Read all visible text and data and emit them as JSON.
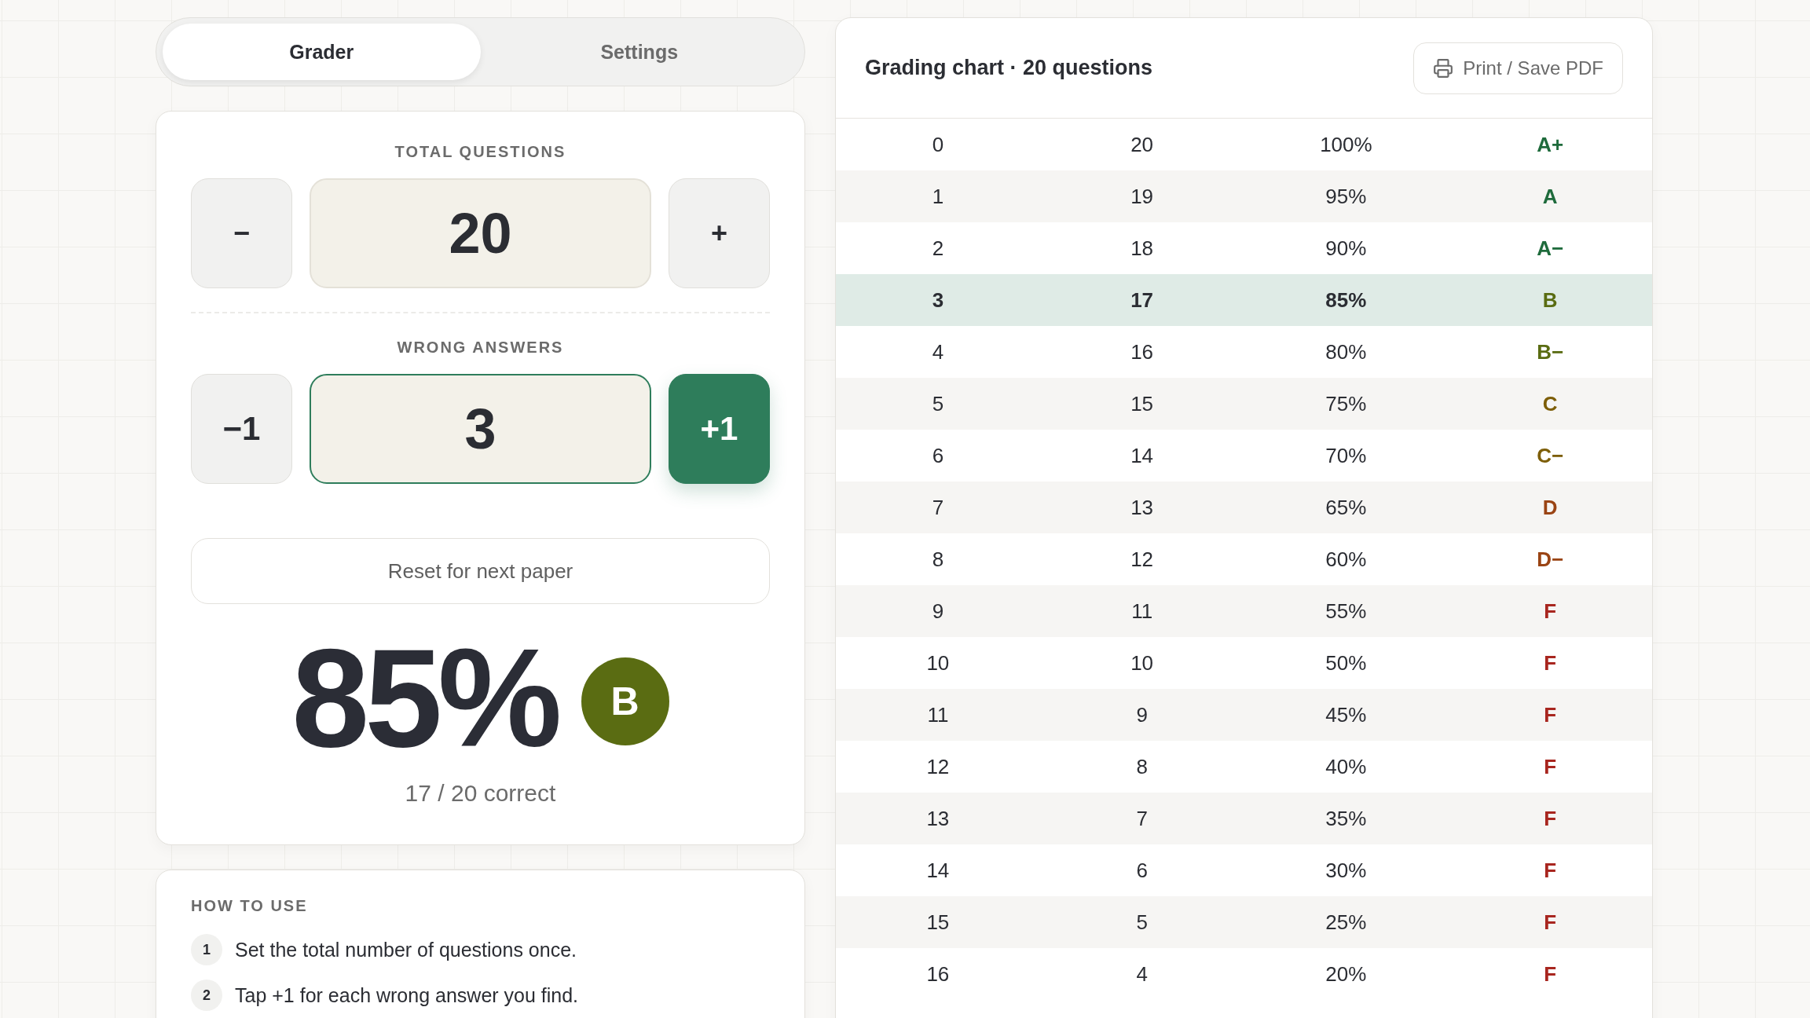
{
  "tabs": [
    {
      "label": "Grader",
      "selected": true
    },
    {
      "label": "Settings",
      "selected": false
    }
  ],
  "steppers": [
    {
      "label": "TOTAL QUESTIONS",
      "decrement": "−",
      "value": "20",
      "increment": "+",
      "active": false
    },
    {
      "label": "WRONG ANSWERS",
      "decrement": "−1",
      "value": "3",
      "increment": "+1",
      "active": true
    }
  ],
  "reset_button": "Reset for next paper",
  "result": {
    "percent": "85%",
    "grade": "B",
    "color": "#5a6c12",
    "summary": "17 / 20 correct"
  },
  "how_to_use": {
    "title": "HOW TO USE",
    "steps": [
      {
        "number": "1",
        "text": "Set the total number of questions once."
      },
      {
        "number": "2",
        "text": "Tap +1 for each wrong answer you find."
      }
    ]
  },
  "grading_chart": {
    "title": "Grading chart · 20 questions",
    "print_button": "Print / Save PDF",
    "rows": [
      {
        "cells": [
          "0",
          "20",
          "100%",
          "A+"
        ],
        "color": "#1f6b3c",
        "selected": false
      },
      {
        "cells": [
          "1",
          "19",
          "95%",
          "A"
        ],
        "color": "#1f6b3c",
        "selected": false
      },
      {
        "cells": [
          "2",
          "18",
          "90%",
          "A−"
        ],
        "color": "#1f6b3c",
        "selected": false
      },
      {
        "cells": [
          "3",
          "17",
          "85%",
          "B"
        ],
        "color": "#5a6c12",
        "selected": true
      },
      {
        "cells": [
          "4",
          "16",
          "80%",
          "B−"
        ],
        "color": "#5a6c12",
        "selected": false
      },
      {
        "cells": [
          "5",
          "15",
          "75%",
          "C"
        ],
        "color": "#7d5e08",
        "selected": false
      },
      {
        "cells": [
          "6",
          "14",
          "70%",
          "C−"
        ],
        "color": "#7d5e08",
        "selected": false
      },
      {
        "cells": [
          "7",
          "13",
          "65%",
          "D"
        ],
        "color": "#9a4414",
        "selected": false
      },
      {
        "cells": [
          "8",
          "12",
          "60%",
          "D−"
        ],
        "color": "#9a4414",
        "selected": false
      },
      {
        "cells": [
          "9",
          "11",
          "55%",
          "F"
        ],
        "color": "#a8261f",
        "selected": false
      },
      {
        "cells": [
          "10",
          "10",
          "50%",
          "F"
        ],
        "color": "#a8261f",
        "selected": false
      },
      {
        "cells": [
          "11",
          "9",
          "45%",
          "F"
        ],
        "color": "#a8261f",
        "selected": false
      },
      {
        "cells": [
          "12",
          "8",
          "40%",
          "F"
        ],
        "color": "#a8261f",
        "selected": false
      },
      {
        "cells": [
          "13",
          "7",
          "35%",
          "F"
        ],
        "color": "#a8261f",
        "selected": false
      },
      {
        "cells": [
          "14",
          "6",
          "30%",
          "F"
        ],
        "color": "#a8261f",
        "selected": false
      },
      {
        "cells": [
          "15",
          "5",
          "25%",
          "F"
        ],
        "color": "#a8261f",
        "selected": false
      },
      {
        "cells": [
          "16",
          "4",
          "20%",
          "F"
        ],
        "color": "#a8261f",
        "selected": false
      }
    ]
  }
}
